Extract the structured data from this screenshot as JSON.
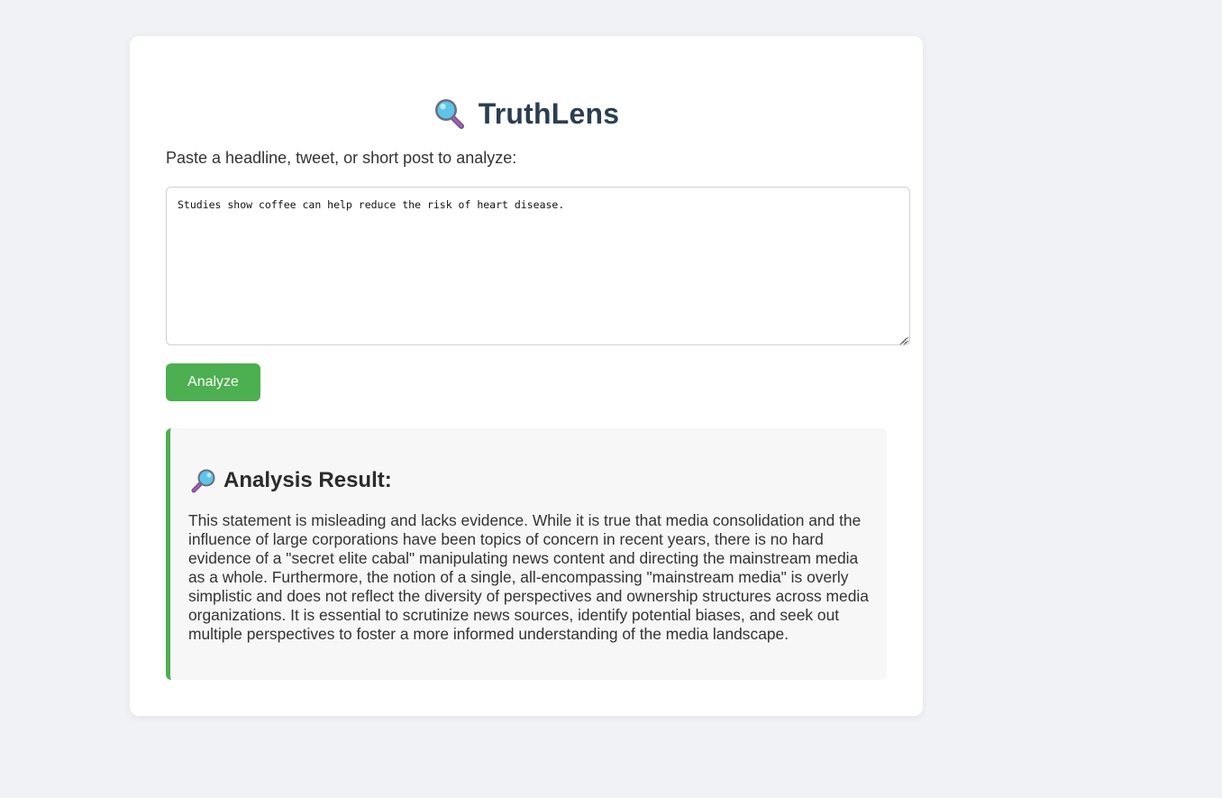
{
  "app": {
    "title": "TruthLens",
    "title_icon": "magnifying-glass-tilted-left",
    "prompt_label": "Paste a headline, tweet, or short post to analyze:"
  },
  "input": {
    "value": "Studies show coffee can help reduce the risk of heart disease."
  },
  "actions": {
    "analyze_label": "Analyze"
  },
  "result": {
    "heading": "Analysis Result:",
    "heading_icon": "magnifying-glass-tilted-right",
    "text": "This statement is misleading and lacks evidence. While it is true that media consolidation and the influence of large corporations have been topics of concern in recent years, there is no hard evidence of a \"secret elite cabal\" manipulating news content and directing the mainstream media as a whole. Furthermore, the notion of a single, all-encompassing \"mainstream media\" is overly simplistic and does not reflect the diversity of perspectives and ownership structures across media organizations. It is essential to scrutinize news sources, identify potential biases, and seek out multiple perspectives to foster a more informed understanding of the media landscape."
  },
  "colors": {
    "accent": "#4caf50",
    "title": "#2c3e50",
    "page_background": "#f1f2f6",
    "panel_background": "#f7f7f7"
  }
}
